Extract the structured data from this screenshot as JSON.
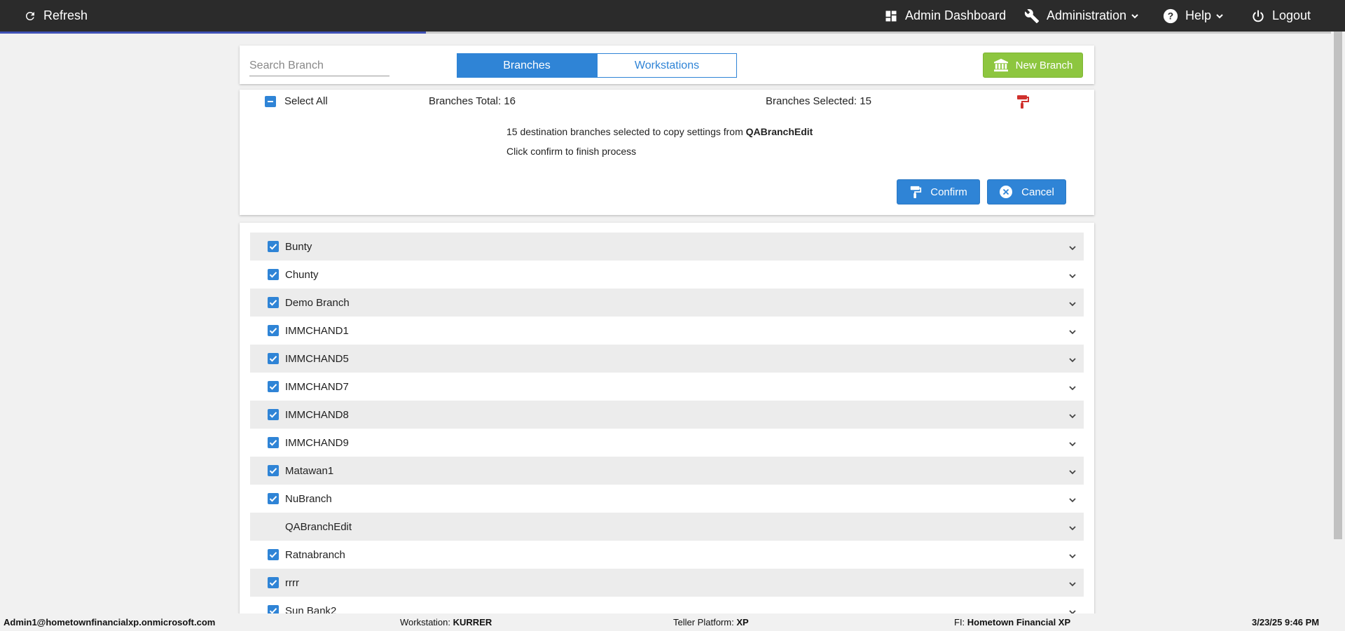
{
  "topbar": {
    "refresh_label": "Refresh",
    "admin_dashboard_label": "Admin Dashboard",
    "administration_label": "Administration",
    "help_label": "Help",
    "logout_label": "Logout",
    "load_progress": 0.32
  },
  "toolbar": {
    "search_placeholder": "Search Branch",
    "tabs": [
      {
        "label": "Branches",
        "active": true
      },
      {
        "label": "Workstations",
        "active": false
      }
    ],
    "new_branch_label": "New Branch"
  },
  "copy_panel": {
    "select_all_label": "Select All",
    "branches_total_label": "Branches Total:",
    "branches_total_value": "16",
    "branches_selected_label": "Branches Selected:",
    "branches_selected_value": "15",
    "message_prefix": "15 destination branches selected to copy settings from",
    "message_source": "QABranchEdit",
    "message_hint": "Click confirm to finish process",
    "confirm_label": "Confirm",
    "cancel_label": "Cancel"
  },
  "branches": [
    {
      "name": "Bunty",
      "checked": true
    },
    {
      "name": "Chunty",
      "checked": true
    },
    {
      "name": "Demo Branch",
      "checked": true
    },
    {
      "name": "IMMCHAND1",
      "checked": true
    },
    {
      "name": "IMMCHAND5",
      "checked": true
    },
    {
      "name": "IMMCHAND7",
      "checked": true
    },
    {
      "name": "IMMCHAND8",
      "checked": true
    },
    {
      "name": "IMMCHAND9",
      "checked": true
    },
    {
      "name": "Matawan1",
      "checked": true
    },
    {
      "name": "NuBranch",
      "checked": true
    },
    {
      "name": "QABranchEdit",
      "checked": false
    },
    {
      "name": "Ratnabranch",
      "checked": true
    },
    {
      "name": "rrrr",
      "checked": true
    },
    {
      "name": "Sun Bank2",
      "checked": true
    }
  ],
  "footer": {
    "user": "Admin1@hometownfinancialxp.onmicrosoft.com",
    "workstation_label": "Workstation:",
    "workstation_value": "KURRER",
    "teller_label": "Teller Platform:",
    "teller_value": "XP",
    "fi_label": "FI:",
    "fi_value": "Hometown Financial XP",
    "datetime": "3/23/25 9:46 PM"
  },
  "colors": {
    "primary": "#2f84d6",
    "success": "#8dc63f",
    "danger": "#d0312d",
    "topbar": "#2b2b2b"
  }
}
